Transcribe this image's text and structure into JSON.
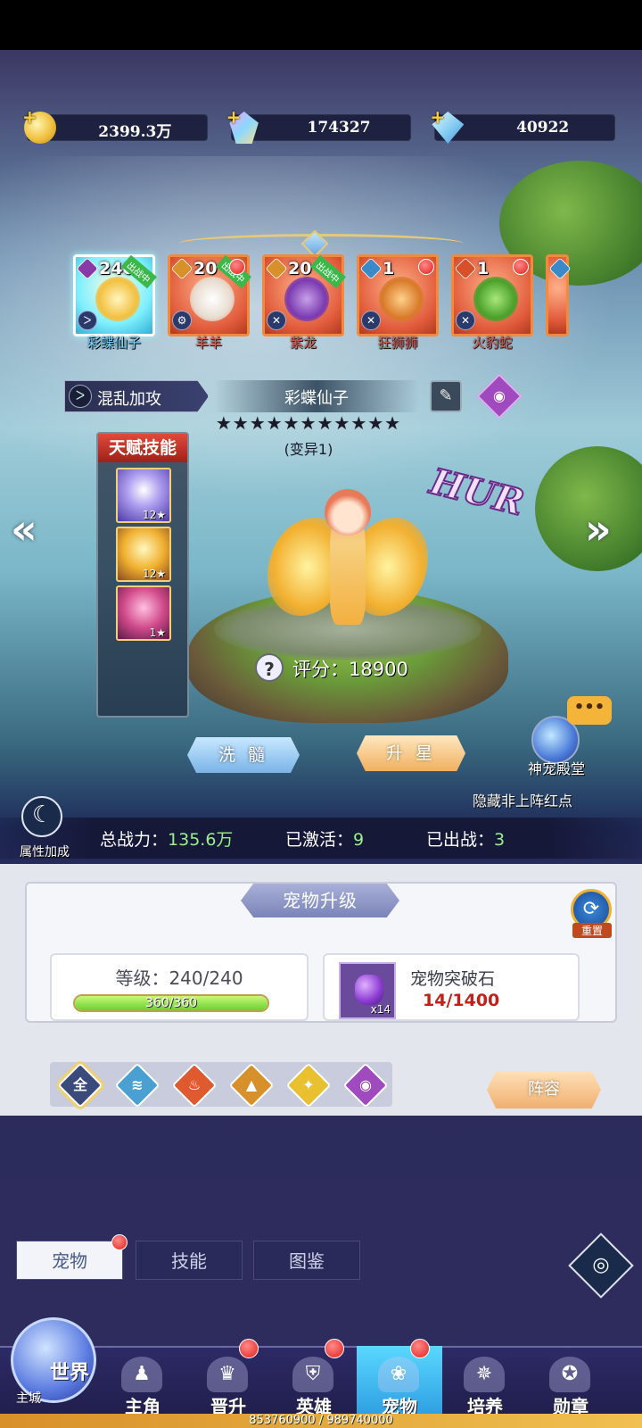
{
  "currency": {
    "gold": "2399.3万",
    "crystal": "174327",
    "diamond": "40922"
  },
  "pets": [
    {
      "level": "240",
      "name": "彩蝶仙子",
      "element": "dark",
      "selected": true,
      "out": "出战中"
    },
    {
      "level": "20",
      "name": "羊羊",
      "element": "earth",
      "out": "出战中"
    },
    {
      "level": "20",
      "name": "紫龙",
      "element": "earth",
      "out": "出战中"
    },
    {
      "level": "1",
      "name": "狂狮狮",
      "element": "water"
    },
    {
      "level": "1",
      "name": "火豹蛇",
      "element": "fire"
    }
  ],
  "skill_tag": "混乱加攻",
  "pet_name": "彩蝶仙子",
  "stars": "★★★★★★★★★★★",
  "variant": "(变异1)",
  "talent_title": "天赋技能",
  "talents": [
    {
      "level": "12★"
    },
    {
      "level": "12★"
    },
    {
      "level": "1★"
    }
  ],
  "rarity": "HUR",
  "score": "评分：18900",
  "buttons": {
    "cleanse": "洗 髓",
    "star_up": "升 星",
    "temple": "神宠殿堂",
    "temple_chat": "•••",
    "hide_red": "隐藏非上阵红点",
    "attr_bonus": "属性加成",
    "lineup": "阵容",
    "reset": "重置"
  },
  "stats": {
    "power_label": "总战力：",
    "power_value": "135.6万",
    "active_label": "已激活：",
    "active_value": "9",
    "deployed_label": "已出战：",
    "deployed_value": "3"
  },
  "upgrade": {
    "title": "宠物升级",
    "level": "等级：240/240",
    "xp_text": "360/360",
    "xp_fraction": 1.0,
    "stone_name": "宠物突破石",
    "stone_count": "x14",
    "stone_need": "14/1400"
  },
  "filters": [
    "全",
    "≋",
    "♨",
    "▲",
    "✦",
    "◉"
  ],
  "sub_tabs": {
    "pet": "宠物",
    "skill": "技能",
    "codex": "图鉴"
  },
  "nav": {
    "world": "世界",
    "main_city": "主城",
    "hero_main": "主角",
    "promote": "晋升",
    "heroes": "英雄",
    "pets": "宠物",
    "train": "培养",
    "medal": "勋章"
  },
  "footer_text": "853760900 / 989740000",
  "colors": {
    "accent": "#2a9adf",
    "alert": "#e0201a",
    "power_green": "#9af08a"
  }
}
